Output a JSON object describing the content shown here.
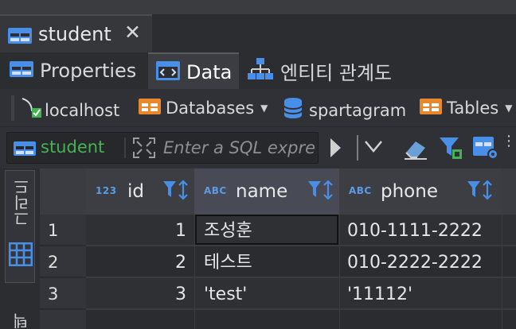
{
  "editor_tab": {
    "title": "student",
    "close_symbol": "✕",
    "icon": "table-icon"
  },
  "sub_tabs": [
    {
      "label": "Properties",
      "icon": "properties-icon"
    },
    {
      "label": "Data",
      "icon": "data-icon"
    },
    {
      "label": "엔티티 관계도",
      "icon": "er-diagram-icon"
    }
  ],
  "breadcrumbs": [
    {
      "label": "localhost",
      "icon": "connection-icon"
    },
    {
      "label": "Databases",
      "icon": "folder-icon"
    },
    {
      "label": "spartagram",
      "icon": "database-icon"
    },
    {
      "label": "Tables",
      "icon": "folder-icon"
    }
  ],
  "filter": {
    "connection": "student",
    "placeholder": "Enter a SQL expression to filter results (use Ctrl+Space)"
  },
  "left_panel": {
    "grid_label": "그리드",
    "text_label": "텍스트"
  },
  "table": {
    "columns": [
      {
        "name": "id",
        "type_badge": "123"
      },
      {
        "name": "name",
        "type_badge": "ABC"
      },
      {
        "name": "phone",
        "type_badge": "ABC"
      }
    ],
    "rows": [
      {
        "num": "1",
        "id": "1",
        "name": "조성훈",
        "phone": "010-1111-2222"
      },
      {
        "num": "2",
        "id": "2",
        "name": "테스트",
        "phone": "010-2222-2222"
      },
      {
        "num": "3",
        "id": "3",
        "name": "'test'",
        "phone": "'11112'"
      }
    ]
  },
  "colors": {
    "accent": "#4a8fe7",
    "connection_green": "#46b352",
    "folder_orange": "#e8872c"
  }
}
